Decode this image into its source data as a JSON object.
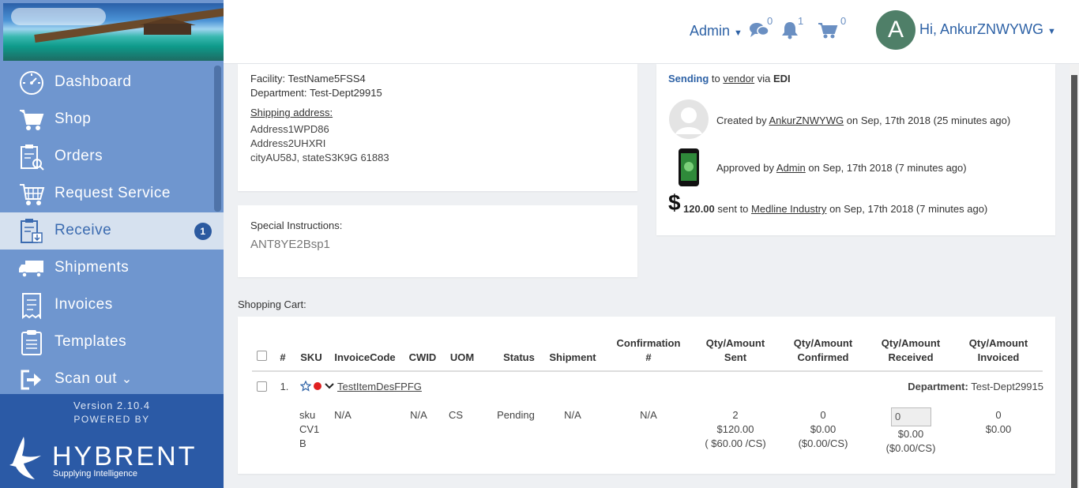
{
  "sidebar": {
    "items": [
      {
        "label": "Dashboard",
        "icon": "dashboard-gauge-icon"
      },
      {
        "label": "Shop",
        "icon": "cart-icon"
      },
      {
        "label": "Orders",
        "icon": "orders-clipboard-icon"
      },
      {
        "label": "Request Service",
        "icon": "service-cart-icon"
      },
      {
        "label": "Receive",
        "icon": "receive-clipboard-icon",
        "badge": "1",
        "active": true
      },
      {
        "label": "Shipments",
        "icon": "truck-icon"
      },
      {
        "label": "Invoices",
        "icon": "invoice-receipt-icon"
      },
      {
        "label": "Templates",
        "icon": "templates-clipboard-icon"
      },
      {
        "label": "Scan out",
        "icon": "sign-out-icon",
        "chevron": "⌄"
      }
    ],
    "version": "Version 2.10.4",
    "powered_by": "POWERED BY",
    "brand_name": "HYBRENT",
    "brand_tagline": "Supplying Intelligence"
  },
  "header": {
    "admin_label": "Admin",
    "messages_count": "0",
    "notifications_count": "1",
    "cart_count": "0",
    "avatar_initial": "A",
    "greeting": "Hi, AnkurZNWYWG"
  },
  "address": {
    "facility_label": "Facility:",
    "facility_value": "TestName5FSS4",
    "department_label": "Department:",
    "department_value": "Test-Dept29915",
    "shipping_label": "Shipping address:",
    "line1": "Address1WPD86",
    "line2": "Address2UHXRI",
    "line3": "cityAU58J, stateS3K9G 61883"
  },
  "special": {
    "label": "Special Instructions:",
    "value": "ANT8YE2Bsp1"
  },
  "activity": {
    "sending_status": "Sending",
    "sending_to": "to",
    "sending_target": "vendor",
    "sending_via": "via",
    "sending_method": "EDI",
    "created_prefix": "Created by",
    "created_user": "AnkurZNWYWG",
    "created_suffix": "on Sep, 17th 2018 (25 minutes ago)",
    "approved_prefix": "Approved by",
    "approved_user": "Admin",
    "approved_suffix": "on Sep, 17th 2018 (7 minutes ago)",
    "dollar_sign": "$",
    "sent_amount": "120.00",
    "sent_prefix": "sent to",
    "sent_vendor": "Medline Industry",
    "sent_suffix": "on Sep, 17th 2018 (7 minutes ago)"
  },
  "cart": {
    "title": "Shopping Cart:",
    "columns": {
      "num": "#",
      "sku": "SKU",
      "invoice_code": "InvoiceCode",
      "cwid": "CWID",
      "uom": "UOM",
      "status": "Status",
      "shipment": "Shipment",
      "confirmation_1": "Confirmation",
      "confirmation_2": "#",
      "qty_sent_1": "Qty/Amount",
      "qty_sent_2": "Sent",
      "qty_confirmed_1": "Qty/Amount",
      "qty_confirmed_2": "Confirmed",
      "qty_received_1": "Qty/Amount",
      "qty_received_2": "Received",
      "qty_invoiced_1": "Qty/Amount",
      "qty_invoiced_2": "Invoiced"
    },
    "row": {
      "num": "1.",
      "item_name": "TestItemDesFPFG",
      "department_label": "Department:",
      "department_value": "Test-Dept29915",
      "sku_1": "sku",
      "sku_2": "CV1",
      "sku_3": "B",
      "invoice_code": "N/A",
      "cwid": "N/A",
      "uom": "CS",
      "status": "Pending",
      "shipment": "N/A",
      "confirmation": "N/A",
      "sent_qty": "2",
      "sent_amount": "$120.00",
      "sent_unit": "( $60.00 /CS)",
      "confirmed_qty": "0",
      "confirmed_amount": "$0.00",
      "confirmed_unit": "($0.00/CS)",
      "received_input": "0",
      "received_amount": "$0.00",
      "received_unit": "($0.00/CS)",
      "invoiced_qty": "0",
      "invoiced_amount": "$0.00"
    }
  },
  "colors": {
    "sidebar": "#6f96cf",
    "sidebar_active": "#d6e1ef",
    "brand": "#2b5aa6",
    "accent": "#2e62a6",
    "avatar": "#4f7f68",
    "flag_red": "#e02020"
  }
}
